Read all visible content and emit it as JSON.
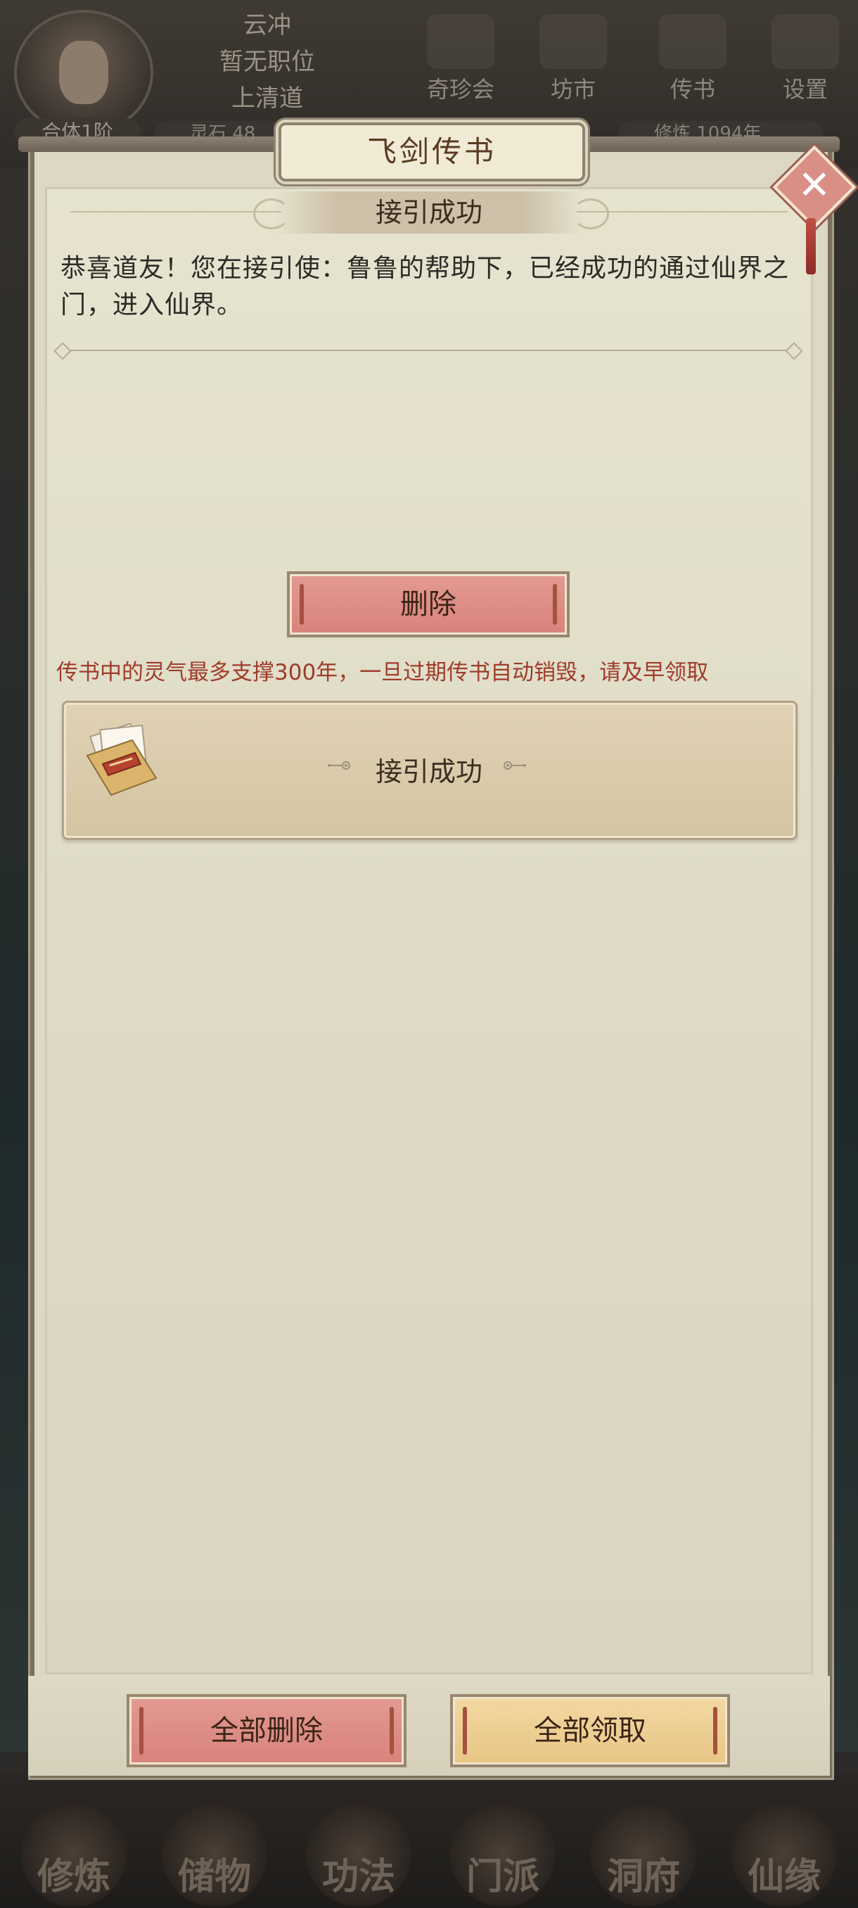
{
  "player": {
    "name": "云冲",
    "position": "暂无职位",
    "sect": "上清道",
    "realm": "合体1阶",
    "spirit_stone": "灵石 48",
    "cultivation": "修炼 1094年"
  },
  "top_nav": [
    {
      "label": "奇珍会",
      "icon": "treasure-pavilion-icon"
    },
    {
      "label": "坊市",
      "icon": "market-icon"
    },
    {
      "label": "传书",
      "icon": "letter-icon"
    },
    {
      "label": "设置",
      "icon": "gear-icon"
    }
  ],
  "bottom_nav": [
    {
      "label": "修炼"
    },
    {
      "label": "储物"
    },
    {
      "label": "功法"
    },
    {
      "label": "门派"
    },
    {
      "label": "洞府"
    },
    {
      "label": "仙缘"
    }
  ],
  "dialog": {
    "title": "飞剑传书",
    "close_icon": "close-icon",
    "side_tag": "退"
  },
  "letter": {
    "subject": "接引成功",
    "body": "恭喜道友！您在接引使：鲁鲁的帮助下，已经成功的通过仙界之门，进入仙界。",
    "delete_label": "删除"
  },
  "notice": "传书中的灵气最多支撑300年，一旦过期传书自动销毁，请及早领取",
  "mail_list": [
    {
      "title": "接引成功",
      "icon": "envelope-icon"
    }
  ],
  "actions": {
    "delete_all": "全部删除",
    "claim_all": "全部领取"
  },
  "colors": {
    "paper": "#ddd9c5",
    "button_red": "#d8827b",
    "button_gold": "#e8c684",
    "notice_text": "#9f3c2a"
  }
}
